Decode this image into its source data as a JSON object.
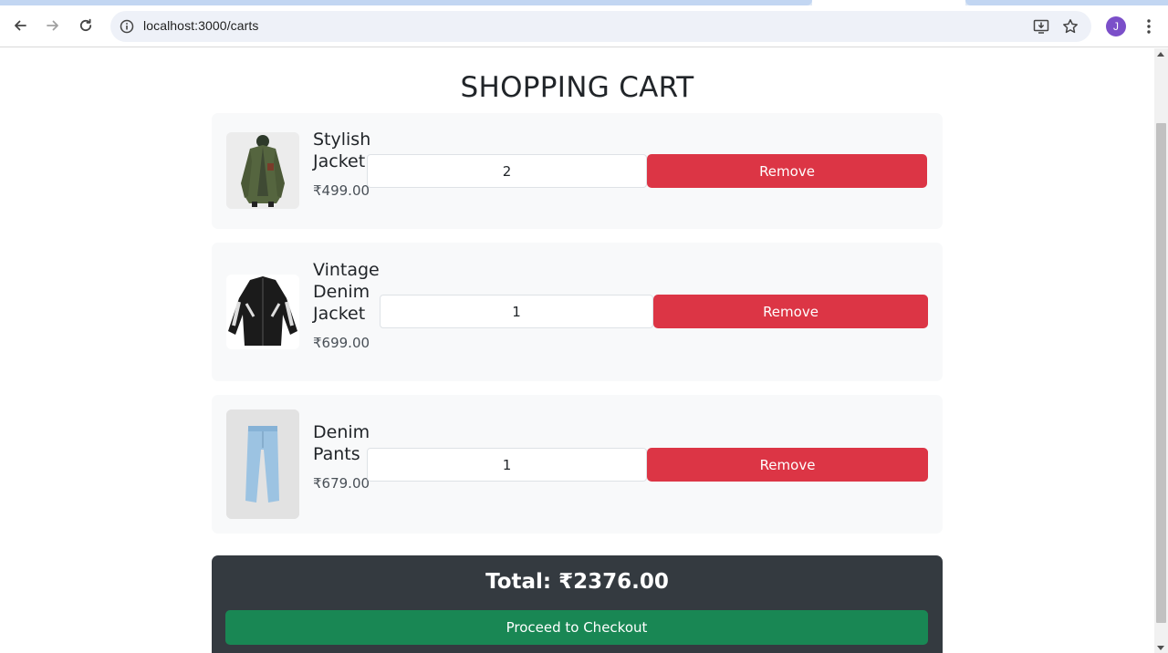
{
  "browser": {
    "url": "localhost:3000/carts",
    "profile_initial": "J"
  },
  "page": {
    "title": "SHOPPING CART"
  },
  "cart": {
    "items": [
      {
        "name_line1": "Stylish",
        "name_line2": "Jacket",
        "name_line3": "",
        "price": "₹499.00",
        "quantity": "2",
        "remove_label": "Remove"
      },
      {
        "name_line1": "Vintage",
        "name_line2": "Denim",
        "name_line3": "Jacket",
        "price": "₹699.00",
        "quantity": "1",
        "remove_label": "Remove"
      },
      {
        "name_line1": "Denim",
        "name_line2": "Pants",
        "name_line3": "",
        "price": "₹679.00",
        "quantity": "1",
        "remove_label": "Remove"
      }
    ],
    "total_label": "Total: ₹2376.00",
    "checkout_label": "Proceed to Checkout"
  },
  "colors": {
    "remove": "#dc3545",
    "checkout": "#198754",
    "summary_bg": "#343a40",
    "card_bg": "#f8f9fa"
  }
}
